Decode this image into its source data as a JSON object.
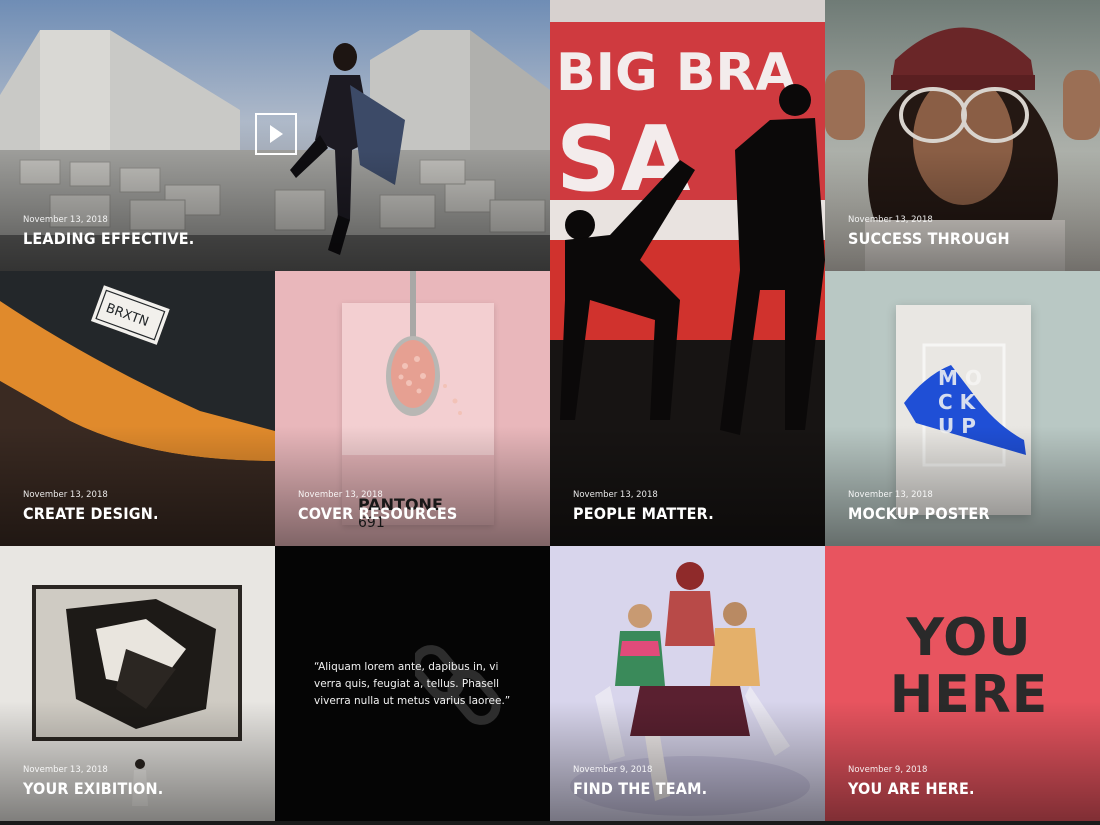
{
  "tiles": [
    {
      "date": "November 13, 2018",
      "title": "LEADING EFFECTIVE."
    },
    {
      "date": "",
      "title": ""
    },
    {
      "date": "November 13, 2018",
      "title": "SUCCESS THROUGH"
    },
    {
      "date": "November 13, 2018",
      "title": "CREATE DESIGN."
    },
    {
      "date": "November 13, 2018",
      "title": "COVER RESOURCES"
    },
    {
      "date": "November 13, 2018",
      "title": "PEOPLE MATTER."
    },
    {
      "date": "November 13, 2018",
      "title": "MOCKUP POSTER"
    },
    {
      "date": "November 13, 2018",
      "title": "YOUR EXIBITION."
    },
    {
      "date": "November 9, 2018",
      "title": "FIND THE TEAM."
    },
    {
      "date": "November 9, 2018",
      "title": "YOU ARE HERE."
    }
  ],
  "quote": "“Aliquam lorem ante, dapibus in, vi verra quis, feugiat a, tellus. Phasell viverra nulla ut metus varius laoree.”",
  "imagery": {
    "sign_text": "BIG BRA SA",
    "cap_label": "BRXTN",
    "pantone_label": "PANTONE",
    "pantone_number": "691",
    "mockup_letters": "MOCKUP",
    "you_here_text": "YOU HERE"
  },
  "icons": {
    "play": "play-icon",
    "link": "link-icon"
  }
}
